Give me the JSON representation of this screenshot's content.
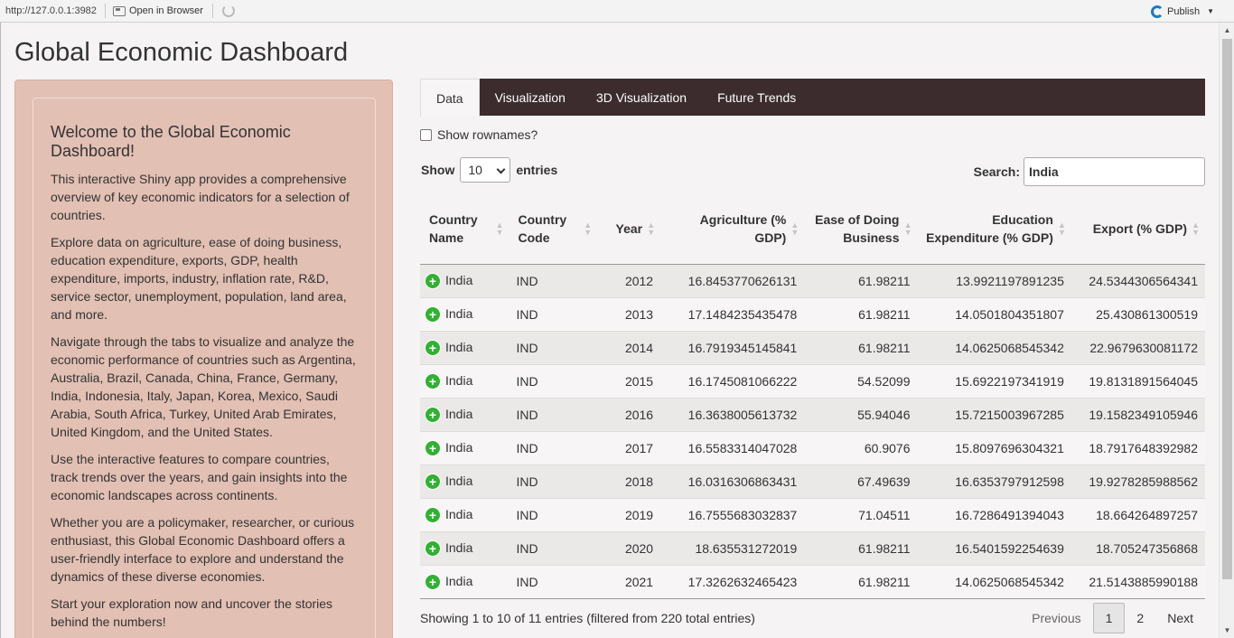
{
  "viewer": {
    "url": "http://127.0.0.1:3982",
    "open_in_browser": "Open in Browser",
    "publish": "Publish"
  },
  "page_title": "Global Economic Dashboard",
  "sidebar": {
    "heading": "Welcome to the Global Economic Dashboard!",
    "paragraphs": [
      "This interactive Shiny app provides a comprehensive overview of key economic indicators for a selection of countries.",
      "Explore data on agriculture, ease of doing business, education expenditure, exports, GDP, health expenditure, imports, industry, inflation rate, R&D, service sector, unemployment, population, land area, and more.",
      "Navigate through the tabs to visualize and analyze the economic performance of countries such as Argentina, Australia, Brazil, Canada, China, France, Germany, India, Indonesia, Italy, Japan, Korea, Mexico, Saudi Arabia, South Africa, Turkey, United Arab Emirates, United Kingdom, and the United States.",
      "Use the interactive features to compare countries, track trends over the years, and gain insights into the economic landscapes across continents.",
      "Whether you are a policymaker, researcher, or curious enthusiast, this Global Economic Dashboard offers a user-friendly interface to explore and understand the dynamics of these diverse economies.",
      "Start your exploration now and uncover the stories behind the numbers!"
    ]
  },
  "tabs": [
    {
      "label": "Data",
      "active": true
    },
    {
      "label": "Visualization",
      "active": false
    },
    {
      "label": "3D Visualization",
      "active": false
    },
    {
      "label": "Future Trends",
      "active": false
    }
  ],
  "controls": {
    "show_rownames": "Show rownames?",
    "show_label": "Show",
    "entries_value": "10",
    "entries_label": "entries",
    "search_label": "Search:",
    "search_value": "India"
  },
  "table": {
    "headers": [
      "Country Name",
      "Country Code",
      "Year",
      "Agriculture (% GDP)",
      "Ease of Doing Business",
      "Education Expenditure (% GDP)",
      "Export (% GDP)"
    ],
    "rows": [
      [
        "India",
        "IND",
        "2012",
        "16.8453770626131",
        "61.98211",
        "13.9921197891235",
        "24.5344306564341"
      ],
      [
        "India",
        "IND",
        "2013",
        "17.1484235435478",
        "61.98211",
        "14.0501804351807",
        "25.430861300519"
      ],
      [
        "India",
        "IND",
        "2014",
        "16.7919345145841",
        "61.98211",
        "14.0625068545342",
        "22.9679630081172"
      ],
      [
        "India",
        "IND",
        "2015",
        "16.1745081066222",
        "54.52099",
        "15.6922197341919",
        "19.8131891564045"
      ],
      [
        "India",
        "IND",
        "2016",
        "16.3638005613732",
        "55.94046",
        "15.7215003967285",
        "19.1582349105946"
      ],
      [
        "India",
        "IND",
        "2017",
        "16.5583314047028",
        "60.9076",
        "15.8097696304321",
        "18.7917648392982"
      ],
      [
        "India",
        "IND",
        "2018",
        "16.0316306863431",
        "67.49639",
        "16.6353797912598",
        "19.9278285988562"
      ],
      [
        "India",
        "IND",
        "2019",
        "16.7555683032837",
        "71.04511",
        "16.7286491394043",
        "18.664264897257"
      ],
      [
        "India",
        "IND",
        "2020",
        "18.635531272019",
        "61.98211",
        "16.5401592254639",
        "18.705247356868"
      ],
      [
        "India",
        "IND",
        "2021",
        "17.3262632465423",
        "61.98211",
        "14.0625068545342",
        "21.5143885990188"
      ]
    ]
  },
  "footer": {
    "info": "Showing 1 to 10 of 11 entries (filtered from 220 total entries)",
    "previous": "Previous",
    "pages": [
      "1",
      "2"
    ],
    "next": "Next"
  }
}
